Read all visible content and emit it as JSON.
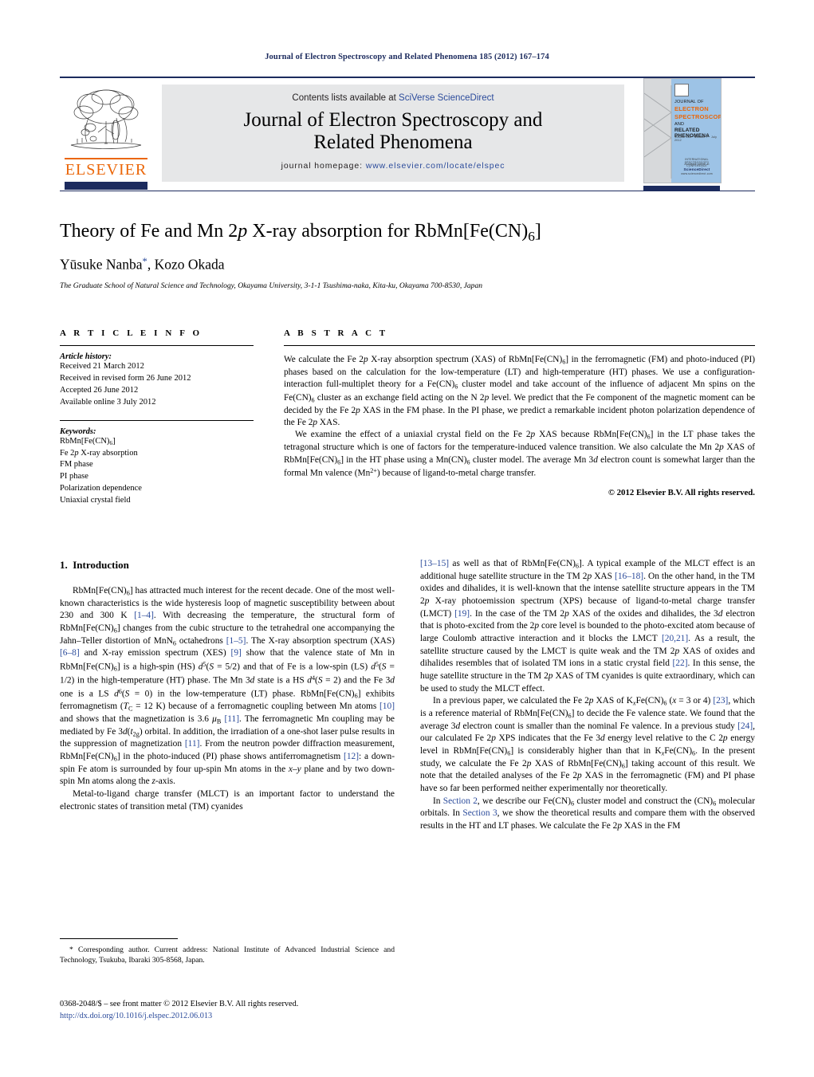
{
  "running_head": "Journal of Electron Spectroscopy and Related Phenomena 185 (2012) 167–174",
  "colors": {
    "navy": "#1c2b5e",
    "link_blue": "#2b4b9b",
    "elsevier_orange": "#eb6608",
    "band_grey": "#e6e7e8",
    "cover_blue": "#9dc3e6"
  },
  "masthead": {
    "contents_prefix": "Contents lists available at ",
    "contents_link": "SciVerse ScienceDirect",
    "journal_title_line1": "Journal of Electron Spectroscopy and",
    "journal_title_line2": "Related Phenomena",
    "homepage_prefix": "journal homepage: ",
    "homepage_url": "www.elsevier.com/locate/elspec",
    "publisher_wordmark": "ELSEVIER",
    "cover": {
      "line1": "JOURNAL OF",
      "line2": "ELECTRON",
      "line3": "SPECTROSCOPY",
      "line4": "AND",
      "line5": "RELATED PHENOMENA",
      "line6": "Volume 185 · Number 7 · July 2012",
      "footer1": "INTERNATIONAL SPECTROSCOPY CONFERENCE",
      "footer2": "Available online at",
      "footer3": "ScienceDirect",
      "footer4": "www.sciencedirect.com"
    }
  },
  "title": {
    "text_pre": "Theory of Fe and Mn 2",
    "italic_p": "p",
    "text_mid": " X-ray absorption for RbMn[Fe(CN)",
    "sub6": "6",
    "text_post": "]",
    "full": "Theory of Fe and Mn 2p X-ray absorption for RbMn[Fe(CN)6]"
  },
  "authors": {
    "name1": "Yūsuke Nanba",
    "star": "*",
    "separator": ", ",
    "name2": "Kozo Okada"
  },
  "affiliation": "The Graduate School of Natural Science and Technology, Okayama University, 3-1-1 Tsushima-naka, Kita-ku, Okayama 700-8530, Japan",
  "article_info": {
    "heading": "A R T I C L E    I N F O",
    "history_label": "Article history:",
    "history": [
      "Received 21 March 2012",
      "Received in revised form 26 June 2012",
      "Accepted 26 June 2012",
      "Available online 3 July 2012"
    ],
    "keywords_label": "Keywords:",
    "keywords": [
      "RbMn[Fe(CN)6]",
      "Fe 2p X-ray absorption",
      "FM phase",
      "PI phase",
      "Polarization dependence",
      "Uniaxial crystal field"
    ]
  },
  "abstract": {
    "heading": "A B S T R A C T",
    "paragraph1": "We calculate the Fe 2p X-ray absorption spectrum (XAS) of RbMn[Fe(CN)6] in the ferromagnetic (FM) and photo-induced (PI) phases based on the calculation for the low-temperature (LT) and high-temperature (HT) phases. We use a configuration-interaction full-multiplet theory for a Fe(CN)6 cluster model and take account of the influence of adjacent Mn spins on the Fe(CN)6 cluster as an exchange field acting on the N 2p level. We predict that the Fe component of the magnetic moment can be decided by the Fe 2p XAS in the FM phase. In the PI phase, we predict a remarkable incident photon polarization dependence of the Fe 2p XAS.",
    "paragraph2": "We examine the effect of a uniaxial crystal field on the Fe 2p XAS because RbMn[Fe(CN)6] in the LT phase takes the tetragonal structure which is one of factors for the temperature-induced valence transition. We also calculate the Mn 2p XAS of RbMn[Fe(CN)6] in the HT phase using a Mn(CN)6 cluster model. The average Mn 3d electron count is somewhat larger than the formal Mn valence (Mn2+) because of ligand-to-metal charge transfer.",
    "copyright": "© 2012 Elsevier B.V. All rights reserved."
  },
  "body": {
    "section_number": "1.",
    "section_title": "Introduction",
    "left_paragraph1": "RbMn[Fe(CN)6] has attracted much interest for the recent decade. One of the most well-known characteristics is the wide hysteresis loop of magnetic susceptibility between about 230 and 300 K [1–4]. With decreasing the temperature, the structural form of RbMn[Fe(CN)6] changes from the cubic structure to the tetrahedral one accompanying the Jahn–Teller distortion of MnN6 octahedrons [1–5]. The X-ray absorption spectrum (XAS) [6–8] and X-ray emission spectrum (XES) [9] show that the valence state of Mn in RbMn[Fe(CN)6] is a high-spin (HS) d5(S = 5/2) and that of Fe is a low-spin (LS) d5(S = 1/2) in the high-temperature (HT) phase. The Mn 3d state is a HS d4(S = 2) and the Fe 3d one is a LS d6(S = 0) in the low-temperature (LT) phase. RbMn[Fe(CN)6] exhibits ferromagnetism (TC = 12 K) because of a ferromagnetic coupling between Mn atoms [10] and shows that the magnetization is 3.6 μB [11]. The ferromagnetic Mn coupling may be mediated by Fe 3d(t2g) orbital. In addition, the irradiation of a one-shot laser pulse results in the suppression of magnetization [11]. From the neutron powder diffraction measurement, RbMn[Fe(CN)6] in the photo-induced (PI) phase shows antiferromagnetism [12]: a down-spin Fe atom is surrounded by four up-spin Mn atoms in the x–y plane and by two down-spin Mn atoms along the z-axis.",
    "left_paragraph2": "Metal-to-ligand charge transfer (MLCT) is an important factor to understand the electronic states of transition metal (TM) cyanides",
    "right_paragraph1": "[13–15] as well as that of RbMn[Fe(CN)6]. A typical example of the MLCT effect is an additional huge satellite structure in the TM 2p XAS [16–18]. On the other hand, in the TM oxides and dihalides, it is well-known that the intense satellite structure appears in the TM 2p X-ray photoemission spectrum (XPS) because of ligand-to-metal charge transfer (LMCT) [19]. In the case of the TM 2p XAS of the oxides and dihalides, the 3d electron that is photo-excited from the 2p core level is bounded to the photo-excited atom because of large Coulomb attractive interaction and it blocks the LMCT [20,21]. As a result, the satellite structure caused by the LMCT is quite weak and the TM 2p XAS of oxides and dihalides resembles that of isolated TM ions in a static crystal field [22]. In this sense, the huge satellite structure in the TM 2p XAS of TM cyanides is quite extraordinary, which can be used to study the MLCT effect.",
    "right_paragraph2": "In a previous paper, we calculated the Fe 2p XAS of KxFe(CN)6 (x = 3 or 4) [23], which is a reference material of RbMn[Fe(CN)6] to decide the Fe valence state. We found that the average 3d electron count is smaller than the nominal Fe valence. In a previous study [24], our calculated Fe 2p XPS indicates that the Fe 3d energy level relative to the C 2p energy level in RbMn[Fe(CN)6] is considerably higher than that in KxFe(CN)6. In the present study, we calculate the Fe 2p XAS of RbMn[Fe(CN)6] taking account of this result. We note that the detailed analyses of the Fe 2p XAS in the ferromagnetic (FM) and PI phase have so far been performed neither experimentally nor theoretically.",
    "right_paragraph3": "In Section 2, we describe our Fe(CN)6 cluster model and construct the (CN)6 molecular orbitals. In Section 3, we show the theoretical results and compare them with the observed results in the HT and LT phases. We calculate the Fe 2p XAS in the FM"
  },
  "footnote": {
    "text": "* Corresponding author. Current address: National Institute of Advanced Industrial Science and Technology, Tsukuba, Ibaraki 305-8568, Japan."
  },
  "footer": {
    "issn_line": "0368-2048/$ – see front matter © 2012 Elsevier B.V. All rights reserved.",
    "doi": "http://dx.doi.org/10.1016/j.elspec.2012.06.013"
  }
}
